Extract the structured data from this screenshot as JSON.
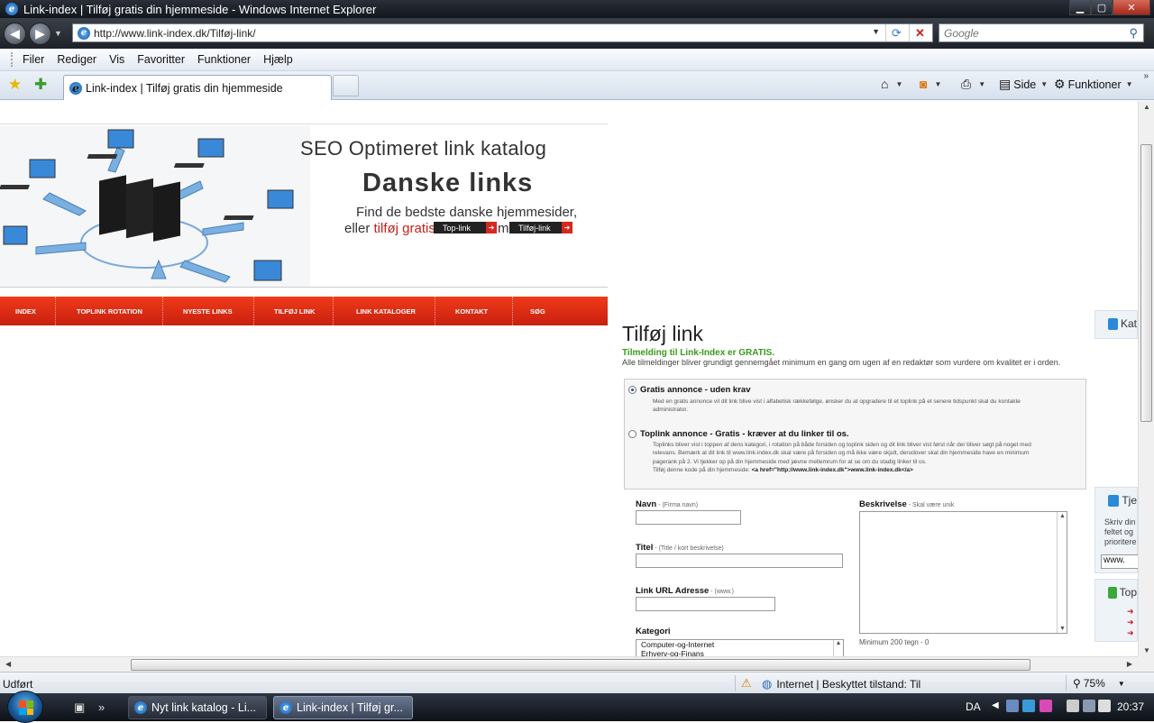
{
  "window": {
    "title": "Link-index | Tilføj gratis din hjemmeside - Windows Internet Explorer",
    "buttons": {
      "minimize": "▁",
      "maximize": "▢",
      "close": "✕"
    }
  },
  "address_bar": {
    "url": "http://www.link-index.dk/Tilføj-link/",
    "search_placeholder": "Google"
  },
  "menu": [
    "Filer",
    "Rediger",
    "Vis",
    "Favoritter",
    "Funktioner",
    "Hjælp"
  ],
  "tab": {
    "title": "Link-index | Tilføj gratis din hjemmeside"
  },
  "command_bar": {
    "page_label": "Side",
    "tools_label": "Funktioner"
  },
  "banner": {
    "tagline": "SEO Optimeret link katalog",
    "headline": "Danske links",
    "line1": "Find de bedste danske hjemmesider,",
    "line2_prefix": "eller ",
    "line2_highlight": "tilføj gratis",
    "line2_mid": "m",
    "btn_toplink": "Top-link",
    "btn_tilfoej": "Tilføj-link"
  },
  "nav": [
    "INDEX",
    "TOPLINK ROTATION",
    "NYESTE LINKS",
    "TILFØJ LINK",
    "LINK KATALOGER",
    "KONTAKT",
    "SØG"
  ],
  "form": {
    "heading": "Tilføj link",
    "free_notice": "Tilmelding til Link-Index er GRATIS.",
    "review_notice": "Alle tilmeldinger bliver grundigt gennemgået minimum en gang om ugen af en redaktør som vurdere om kvalitet er i orden.",
    "option_free": {
      "label": "Gratis annonce - uden krav",
      "selected": true,
      "desc": "Med en gratis annonce vil dit link blive vist i alfabetisk rækkefølge, ønsker du at opgradere til et toplink på et senere tidspunkt skal du kontakte administrator."
    },
    "option_toplink": {
      "label": "Toplink annonce - Gratis - kræver at du linker til os.",
      "selected": false,
      "desc": "Toplinks bliver vist i toppen af dens kategori, i rotation på både forsiden og toplink siden og dit link bliver vist først når der bliver søgt på noget med relevans.  Bemærk at dit link til www.link-index.dk skal være på forsiden og må ikke være skjult, derudover skal din hjemmeside have en minimum pagerank på 2. Vi tjekker op på din hjemmeside med jævne mellemrum for at se om du stadig linker til os.",
      "code_prefix": "Tilføj denne kode på din hjemmeside: ",
      "code": "<a href=\"http://www.link-index.dk\">www.link-index.dk</a>"
    },
    "name_label": "Navn",
    "name_hint": " - (Firma navn)",
    "title_label": "Titel",
    "title_hint": " - (Title / kort beskrivelse)",
    "url_label": "Link URL Adresse",
    "url_hint": " - (www.)",
    "category_label": "Kategori",
    "categories": [
      "Computer-og-Internet",
      "Erhverv-og-Finans"
    ],
    "desc_label": "Beskrivelse",
    "desc_hint": " - Skal være unik",
    "min_chars": "Minimum 200 tegn - 0"
  },
  "right_column": {
    "box1_title": "Kat",
    "box2_title": "Tje",
    "box2_text": [
      "Skriv din",
      "feltet og",
      "prioritere"
    ],
    "box2_input": "www.",
    "box3_title": "Top",
    "arrows": [
      "➜",
      "➜",
      "➜"
    ]
  },
  "status": {
    "left": "Udført",
    "zone": "Internet | Beskyttet tilstand: Til",
    "zoom": "75%"
  },
  "taskbar": {
    "tasks": [
      "Nyt link katalog - Li...",
      "Link-index | Tilføj gr..."
    ],
    "lang": "DA",
    "clock": "20:37"
  }
}
